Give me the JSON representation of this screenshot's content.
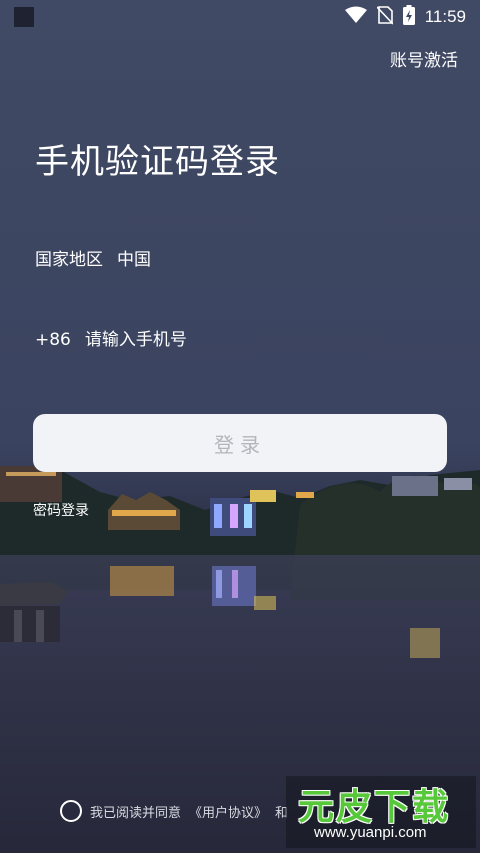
{
  "status_bar": {
    "time": "11:59"
  },
  "header": {
    "activate_label": "账号激活"
  },
  "page": {
    "title": "手机验证码登录"
  },
  "region": {
    "label": "国家地区",
    "value": "中国"
  },
  "phone": {
    "country_code": "+86",
    "placeholder": "请输入手机号"
  },
  "login_button": {
    "label": "登录"
  },
  "password_login": {
    "label": "密码登录"
  },
  "agreement": {
    "prefix": "我已阅读并同意",
    "user_agreement": "《用户协议》",
    "connector": "和"
  },
  "watermark": {
    "logo": "元皮下载",
    "url": "www.yuanpi.com"
  },
  "colors": {
    "button_bg": "#f2f3f6",
    "button_text": "#b3b5bb",
    "watermark_green": "#58c83b"
  }
}
